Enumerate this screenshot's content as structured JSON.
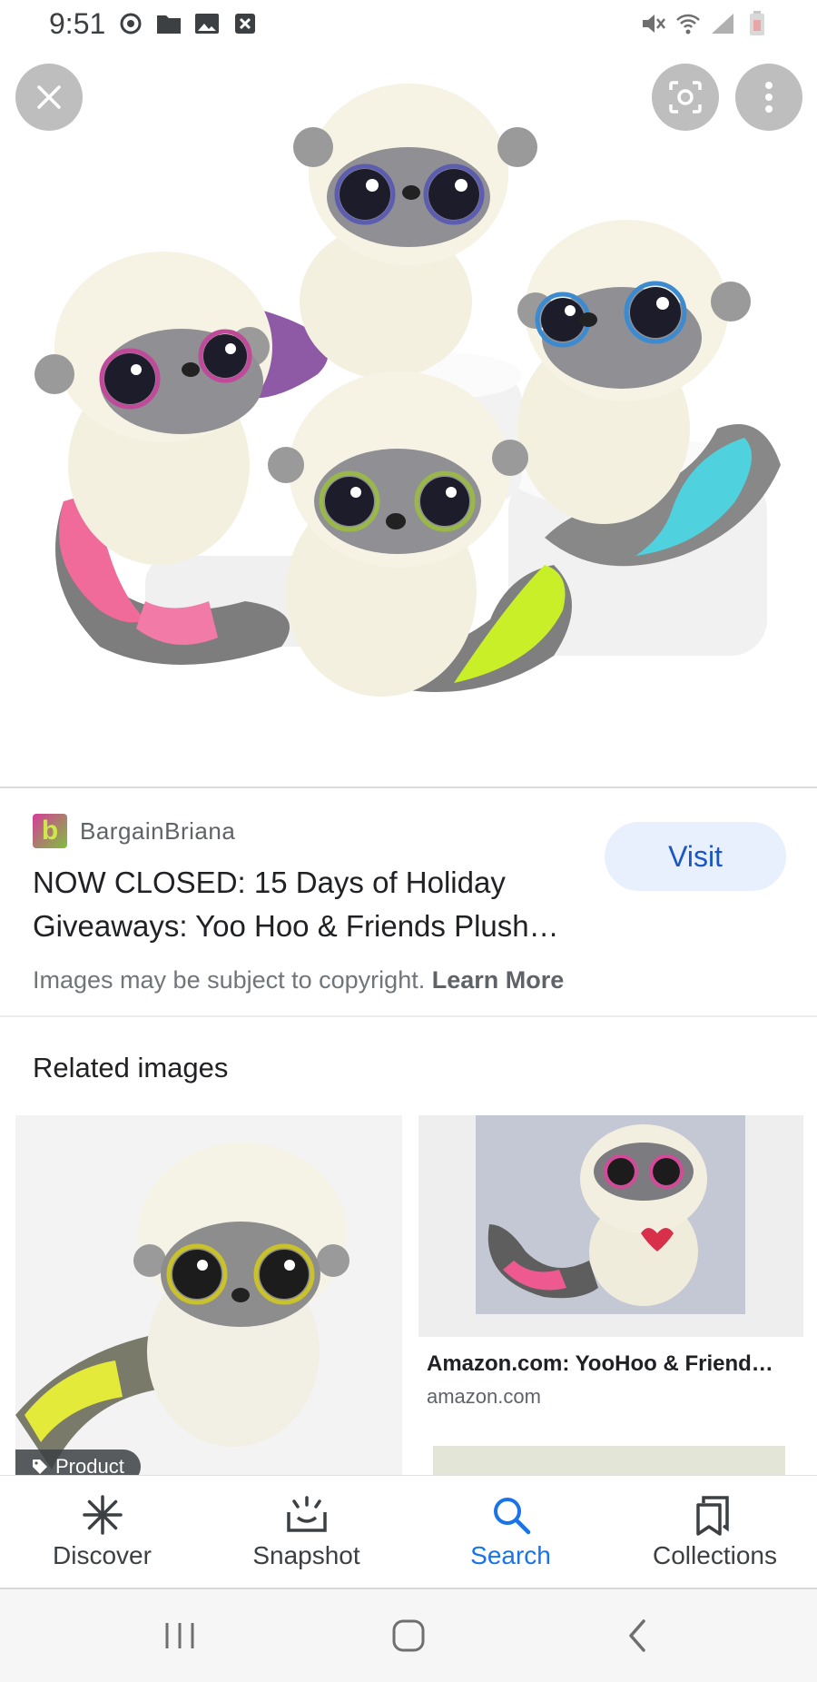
{
  "status_bar": {
    "time": "9:51",
    "left_icons": [
      "sync-icon",
      "folder-icon",
      "image-icon",
      "blocked-icon"
    ],
    "right_icons": [
      "mute-icon",
      "wifi-icon",
      "signal-icon",
      "battery-icon"
    ]
  },
  "viewer": {
    "close_icon": "close-icon",
    "lens_icon": "lens-icon",
    "more_icon": "more-vert-icon"
  },
  "result": {
    "favicon_letter": "b",
    "source_name": "BargainBriana",
    "visit_label": "Visit",
    "title": "NOW CLOSED: 15 Days of Holiday Giveaways: Yoo Hoo & Friends Plush…",
    "copyright_text": "Images may be subject to copyright.",
    "learn_more": "Learn More"
  },
  "related": {
    "heading": "Related images",
    "items": [
      {
        "chip": "Product"
      },
      {
        "title": "Amazon.com: YooHoo & Friend…",
        "domain": "amazon.com"
      }
    ]
  },
  "bottom_nav": {
    "items": [
      {
        "label": "Discover",
        "icon": "asterisk-icon",
        "active": false
      },
      {
        "label": "Snapshot",
        "icon": "snapshot-icon",
        "active": false
      },
      {
        "label": "Search",
        "icon": "search-icon",
        "active": true
      },
      {
        "label": "Collections",
        "icon": "collections-icon",
        "active": false
      }
    ]
  },
  "system_nav": [
    "recents-icon",
    "home-icon",
    "back-icon"
  ],
  "colors": {
    "accent": "#1a73e8",
    "visit_bg": "#e8f0fe",
    "visit_text": "#1a56c4"
  }
}
